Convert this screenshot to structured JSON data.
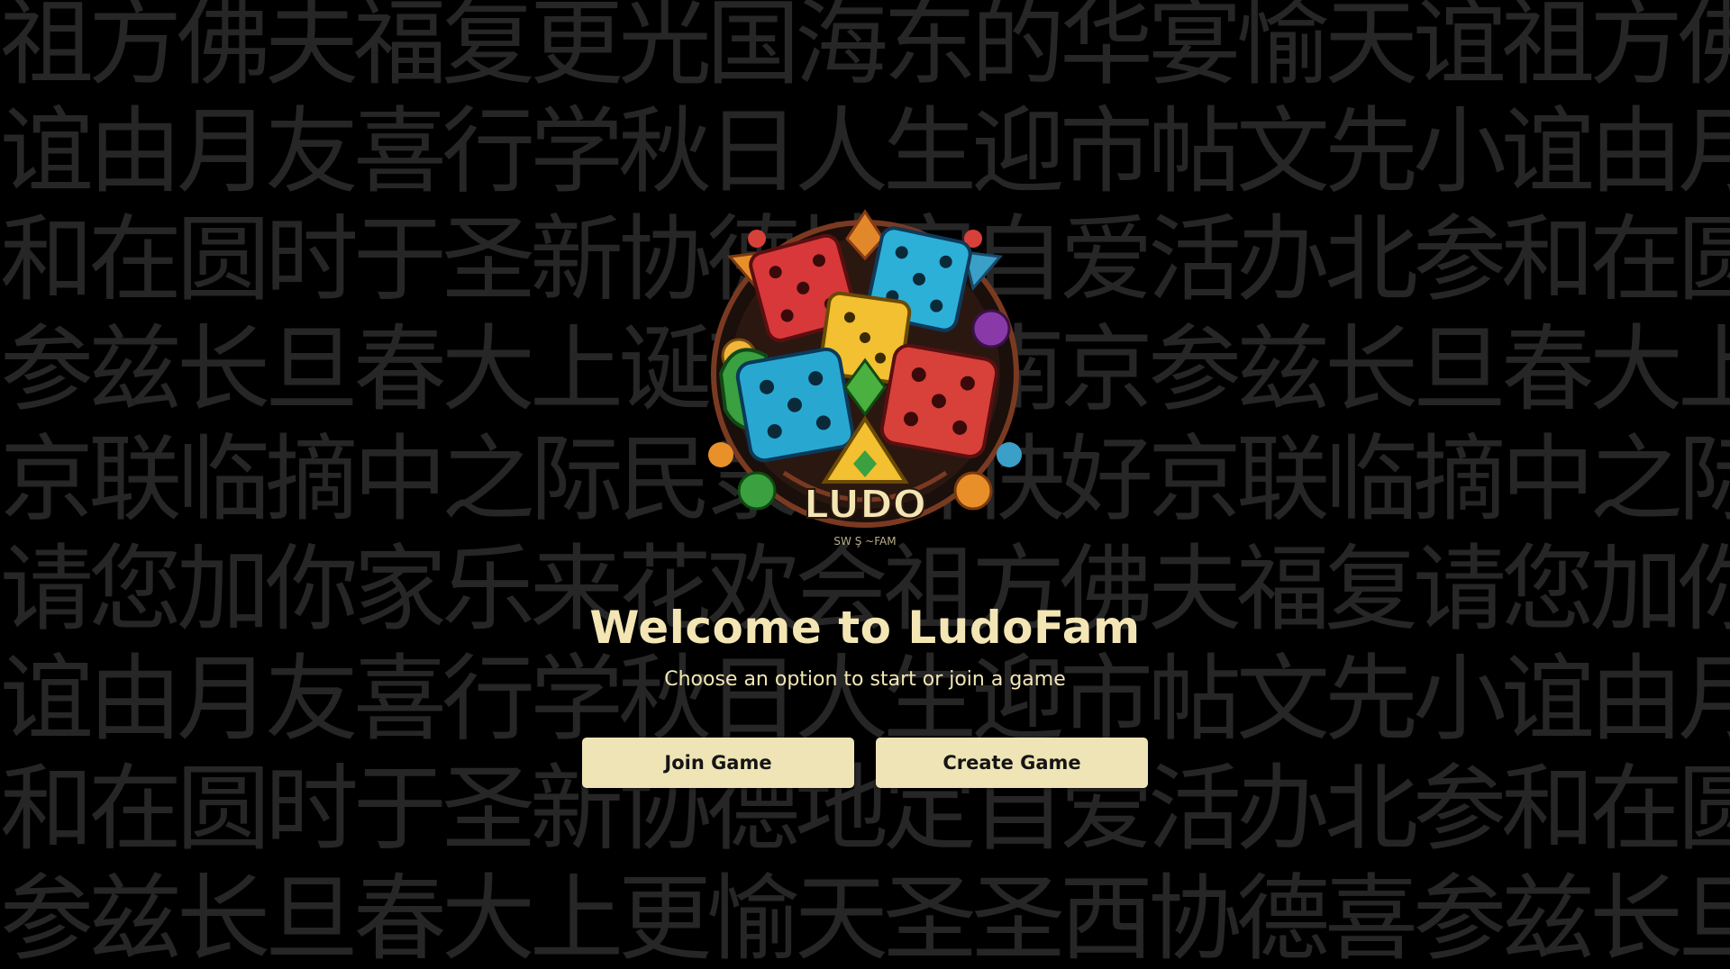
{
  "background": {
    "rows": [
      "祖方佛夫福复更光国海东的华宴愉天谊祖方佛夫福复",
      "谊由月友喜行学秋日人生迎市帖文先小谊由月友喜行",
      "和在圆时于圣新协德地定自爱活办北参和在圆时于圣",
      "参兹长旦春大上诞节明亲南京参兹长旦春大上诞",
      "京联临摘中之际民隶年开快好京联临摘中之际",
      "请您加你家乐来花欢会祖方佛夫福复请您加你家乐",
      "谊由月友喜行学秋日人生迎市帖文先小谊由月友喜行",
      "和在圆时于圣新协德地定自爱活办北参和在圆时于圣",
      "参兹长旦春大上更愉天圣圣西协德喜参兹长旦春"
    ],
    "color": "#262626"
  },
  "logo": {
    "title": "LUDO",
    "tagline": "SW Ş ~FAM"
  },
  "welcome": {
    "title": "Welcome to LudoFam",
    "subtitle": "Choose an option to start or join a game"
  },
  "actions": {
    "join_label": "Join Game",
    "create_label": "Create Game"
  },
  "colors": {
    "background": "#000000",
    "text_accent": "#f3e6b4",
    "button_bg": "#efe4b6",
    "button_text": "#151515"
  }
}
